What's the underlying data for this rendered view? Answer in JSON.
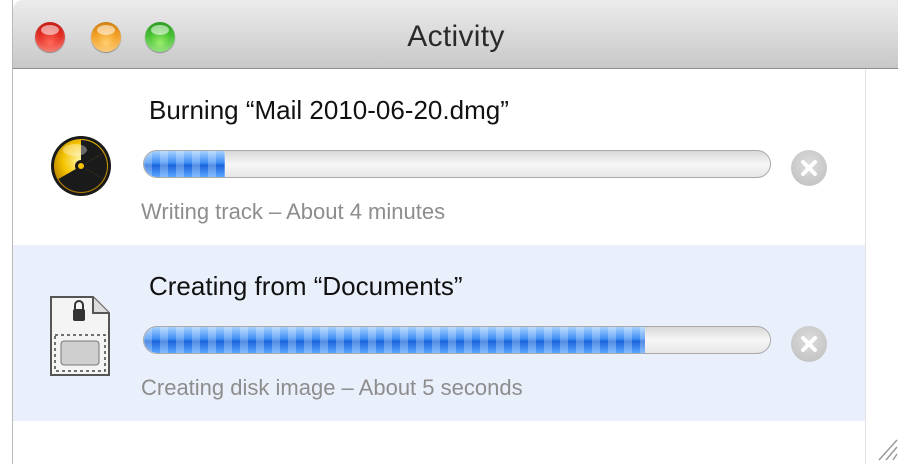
{
  "window": {
    "title": "Activity"
  },
  "tasks": [
    {
      "icon": "burn-icon",
      "title": "Burning “Mail 2010-06-20.dmg”",
      "progress": 0.13,
      "status": "Writing track – About 4 minutes"
    },
    {
      "icon": "disk-image-icon",
      "title": "Creating from “Documents”",
      "progress": 0.8,
      "status": "Creating disk image – About 5 seconds"
    }
  ],
  "colors": {
    "progress_fill": "#3f8ef3",
    "selected_row": "#eaf0fb",
    "status_text": "#8d8d8d"
  }
}
